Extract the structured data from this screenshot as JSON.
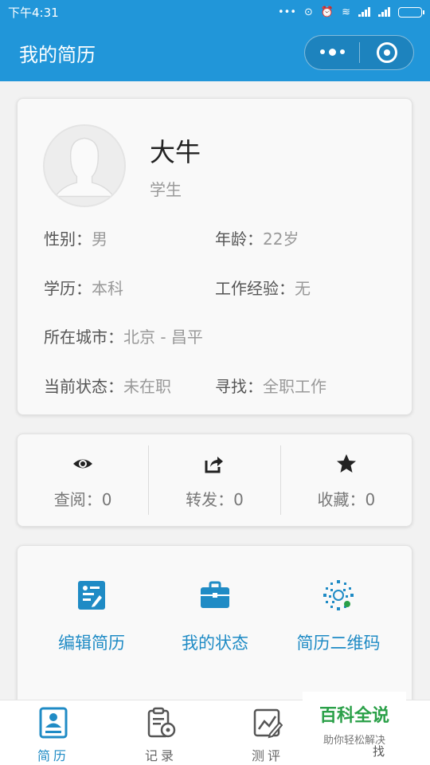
{
  "status_bar": {
    "time": "下午4:31",
    "dots": "•••",
    "clock": "⊙",
    "alarm": "⏰",
    "wifi": "≋"
  },
  "header": {
    "title": "我的简历"
  },
  "profile": {
    "name": "大牛",
    "role": "学生",
    "fields": [
      {
        "label": "性别：",
        "value": "男"
      },
      {
        "label": "年龄：",
        "value": "22岁"
      },
      {
        "label": "学历：",
        "value": "本科"
      },
      {
        "label": "工作经验：",
        "value": "无"
      },
      {
        "label": "所在城市：",
        "value": "北京 - 昌平"
      },
      {
        "label": "当前状态：",
        "value": "未在职"
      },
      {
        "label": "寻找：",
        "value": "全职工作"
      }
    ]
  },
  "stats": [
    {
      "label": "查阅：0",
      "icon": "eye-icon"
    },
    {
      "label": "转发：0",
      "icon": "share-icon"
    },
    {
      "label": "收藏：0",
      "icon": "star-icon"
    }
  ],
  "actions": [
    {
      "label": "编辑简历",
      "icon": "edit-resume-icon"
    },
    {
      "label": "我的状态",
      "icon": "briefcase-icon"
    },
    {
      "label": "简历二维码",
      "icon": "qrcode-icon"
    }
  ],
  "tabs": [
    {
      "label": "简历",
      "icon": "resume-icon"
    },
    {
      "label": "记录",
      "icon": "record-icon"
    },
    {
      "label": "测评",
      "icon": "assessment-icon"
    },
    {
      "label": "找",
      "icon": "search-icon"
    }
  ],
  "watermark": {
    "title": "百科全说",
    "subtitle": "助你轻松解决"
  },
  "colors": {
    "primary": "#2196d9",
    "accent": "#1f8bc5",
    "watermark_green": "#2aa048"
  }
}
